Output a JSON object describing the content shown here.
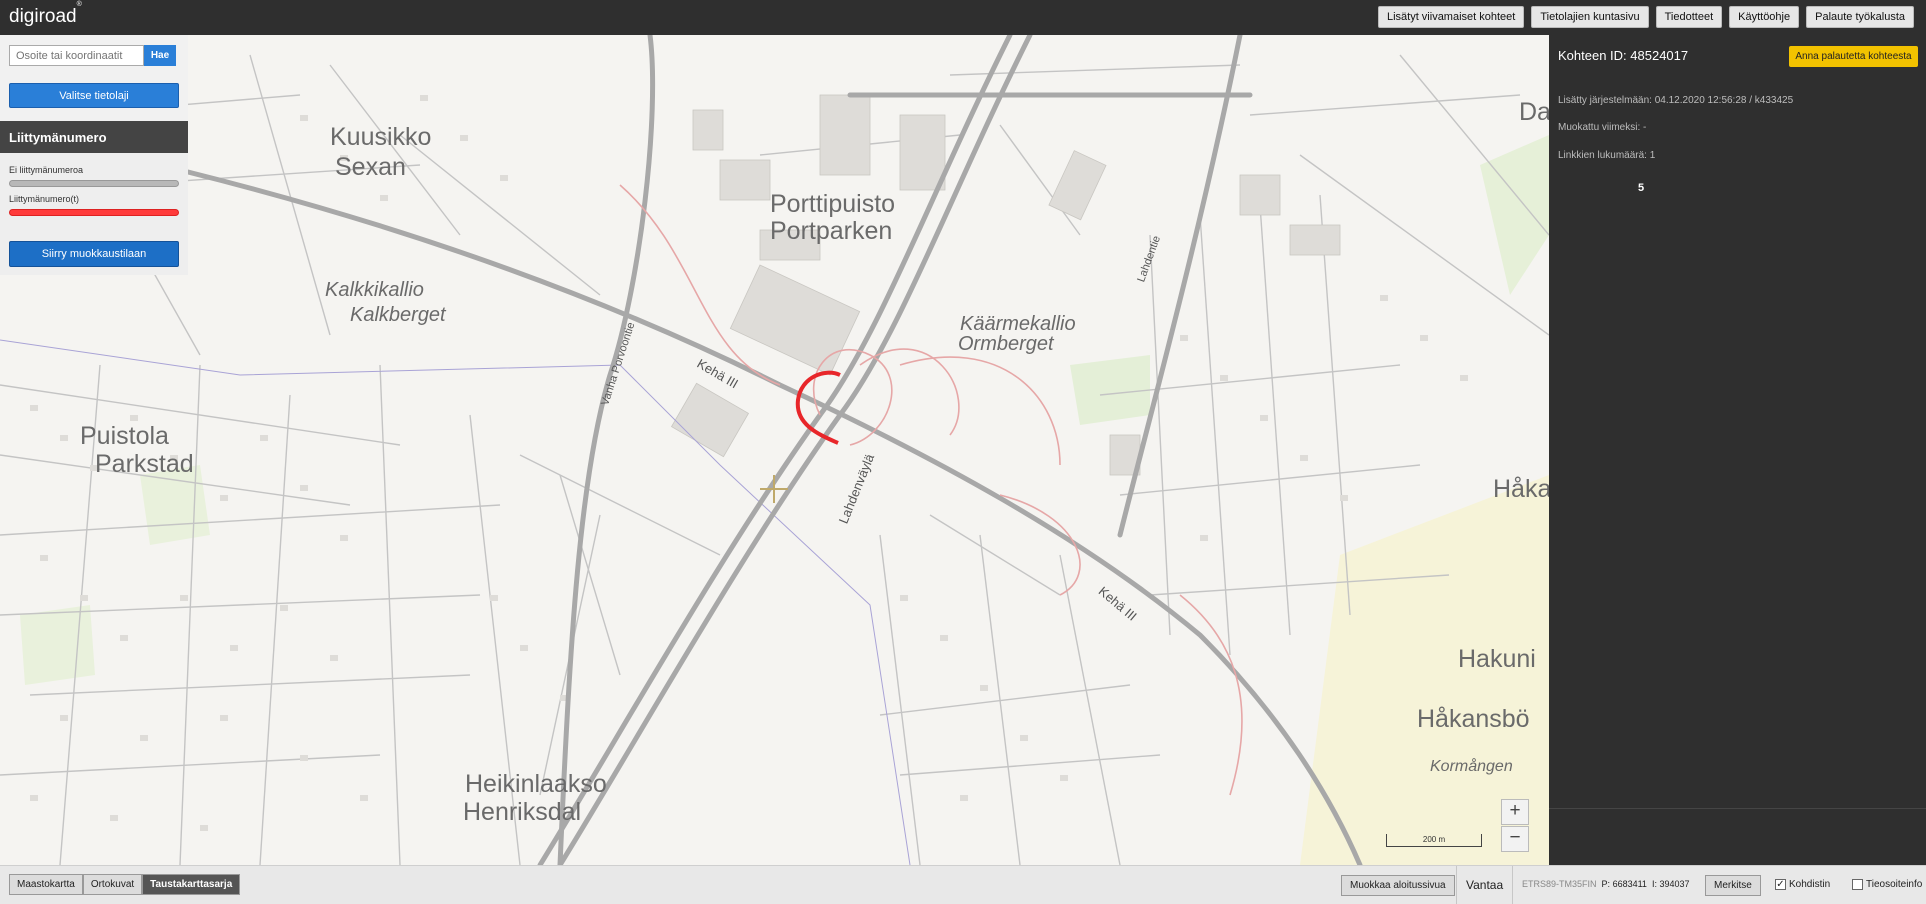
{
  "app": {
    "logo": "digiroad",
    "logo_mark": "®"
  },
  "topnav": [
    "Lisätyt viivamaiset kohteet",
    "Tietolajien kuntasivu",
    "Tiedotteet",
    "Käyttöohje",
    "Palaute työkalusta"
  ],
  "search": {
    "placeholder": "Osoite tai koordinaatit",
    "button": "Hae"
  },
  "layer_button": "Valitse tietolaji",
  "legend": {
    "title": "Liittymänumero",
    "items": [
      {
        "label": "Ei liittymänumeroa",
        "color": "#b8b8b8"
      },
      {
        "label": "Liittymänumero(t)",
        "color": "#ff3b3b"
      }
    ]
  },
  "edit_button": "Siirry muokkaustilaan",
  "detail": {
    "title": "Kohteen ID: 48524017",
    "feedback_button": "Anna palautetta kohteesta",
    "added": "Lisätty järjestelmään: 04.12.2020 12:56:28 / k433425",
    "modified": "Muokattu viimeksi: -",
    "links": "Linkkien lukumäärä: 1",
    "number": "5"
  },
  "map": {
    "places": [
      "Kuusikko",
      "Sexan",
      "Porttipuisto",
      "Portparken",
      "Kalkkikallio",
      "Kalkberget",
      "Käärmekallio",
      "Ormberget",
      "Puistola",
      "Parkstad",
      "Heikinlaakso",
      "Henriksdal",
      "Dal",
      "Håka",
      "Hakuni",
      "Håkansbö",
      "Kormången"
    ],
    "roads": [
      "Kehä III",
      "Lahdenväylä",
      "Vanha Porvoontie",
      "Lahdentie",
      "Kehä III"
    ],
    "scale_label": "200 m",
    "zoom_in": "+",
    "zoom_out": "−"
  },
  "bottom": {
    "backgrounds": [
      "Maastokartta",
      "Ortokuvat",
      "Taustakarttasarja"
    ],
    "active_background": "Taustakarttasarja",
    "start_page_button": "Muokkaa aloitussivua",
    "municipality": "Vantaa",
    "crs": "ETRS89-TM35FIN",
    "p_label": "P:",
    "p_value": "6683411",
    "i_label": "I:",
    "i_value": "394037",
    "mark_button": "Merkitse",
    "crosshair_label": "Kohdistin",
    "crosshair_checked": true,
    "roadinfo_label": "Tieosoiteinfo",
    "roadinfo_checked": false
  }
}
